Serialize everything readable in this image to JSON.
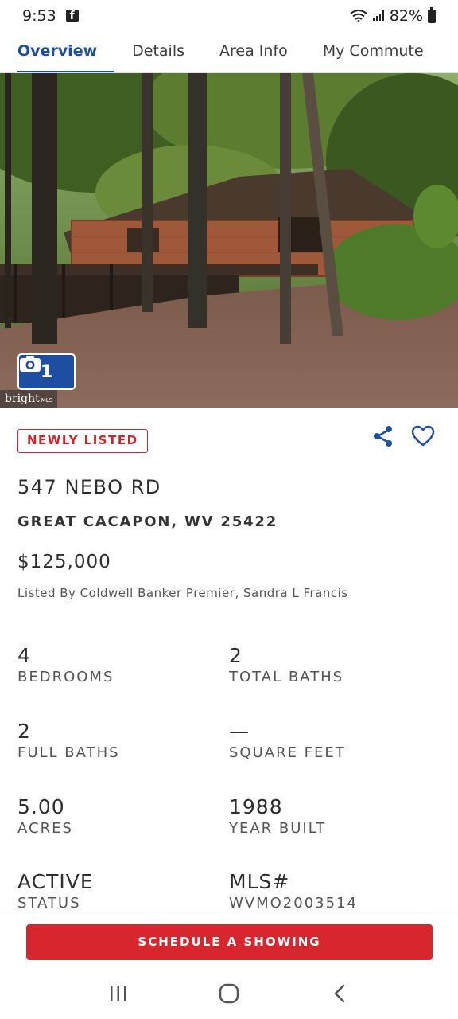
{
  "status_bar": {
    "time": "9:53",
    "battery": "82%",
    "app_icon": "facebook-icon"
  },
  "tabs": [
    {
      "label": "Overview",
      "active": true
    },
    {
      "label": "Details",
      "active": false
    },
    {
      "label": "Area Info",
      "active": false
    },
    {
      "label": "My Commute",
      "active": false
    }
  ],
  "hero": {
    "photo_count": "1",
    "watermark": "bright",
    "watermark_suffix": "MLS"
  },
  "listing": {
    "badge": "NEWLY LISTED",
    "address_line1": "547 NEBO RD",
    "address_line2": "GREAT CACAPON, WV 25422",
    "price": "$125,000",
    "listed_by": "Listed By Coldwell Banker Premier, Sandra L Francis"
  },
  "facts": [
    {
      "value": "4",
      "label": "BEDROOMS"
    },
    {
      "value": "2",
      "label": "TOTAL BATHS"
    },
    {
      "value": "2",
      "label": "FULL BATHS"
    },
    {
      "value": "—",
      "label": "SQUARE FEET"
    },
    {
      "value": "5.00",
      "label": "ACRES"
    },
    {
      "value": "1988",
      "label": "YEAR BUILT"
    },
    {
      "value": "ACTIVE",
      "label": "STATUS"
    },
    {
      "value": "MLS#",
      "label": "WVMO2003514"
    }
  ],
  "cta": {
    "label": "SCHEDULE A SHOWING"
  },
  "colors": {
    "brand_blue": "#1e4ea1",
    "accent_red": "#d2232a",
    "cta_red": "#d8262e"
  }
}
